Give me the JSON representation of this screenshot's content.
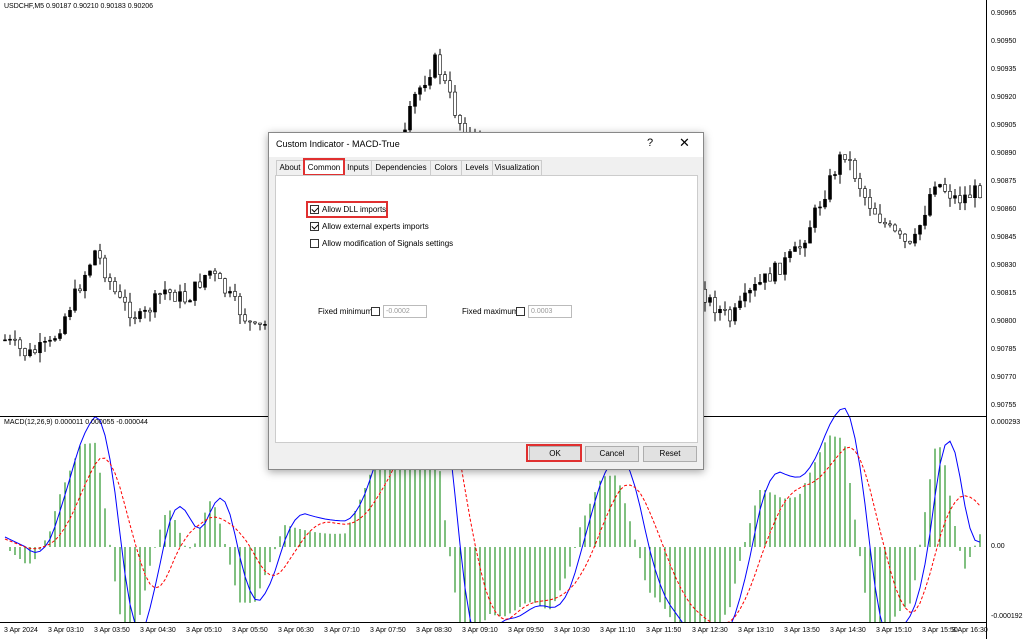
{
  "chart": {
    "symbol_info": "USDCHF,M5  0.90187 0.90210 0.90183 0.90206",
    "macd_info": "MACD(12,26,9) 0.000011 0.000055 -0.000044",
    "price_labels": [
      "0.90965",
      "0.90950",
      "0.90935",
      "0.90920",
      "0.90905",
      "0.90890",
      "0.90875",
      "0.90860",
      "0.90845",
      "0.90830",
      "0.90815",
      "0.90800",
      "0.90785",
      "0.90770",
      "0.90755"
    ],
    "macd_labels": [
      "0.000293",
      "0.00",
      "-0.000192"
    ],
    "time_labels": [
      "3 Apr 2024",
      "3 Apr 03:10",
      "3 Apr 03:50",
      "3 Apr 04:30",
      "3 Apr 05:10",
      "3 Apr 05:50",
      "3 Apr 06:30",
      "3 Apr 07:10",
      "3 Apr 07:50",
      "3 Apr 08:30",
      "3 Apr 09:10",
      "3 Apr 09:50",
      "3 Apr 10:30",
      "3 Apr 11:10",
      "3 Apr 11:50",
      "3 Apr 12:30",
      "3 Apr 13:10",
      "3 Apr 13:50",
      "3 Apr 14:30",
      "3 Apr 15:10",
      "3 Apr 15:50",
      "3 Apr 16:30"
    ]
  },
  "dialog": {
    "title": "Custom Indicator - MACD-True",
    "help": "?",
    "close": "✕",
    "tabs": [
      "About",
      "Common",
      "Inputs",
      "Dependencies",
      "Colors",
      "Levels",
      "Visualization"
    ],
    "active_tab": "Common",
    "checkboxes": [
      {
        "label": "Allow DLL imports",
        "checked": true
      },
      {
        "label": "Allow external experts imports",
        "checked": true
      },
      {
        "label": "Allow modification of Signals settings",
        "checked": false
      }
    ],
    "fixed_minimum": {
      "label": "Fixed minimum",
      "value": "-0.0002"
    },
    "fixed_maximum": {
      "label": "Fixed maximum",
      "value": "0.0003"
    },
    "buttons": {
      "ok": "OK",
      "cancel": "Cancel",
      "reset": "Reset"
    }
  },
  "colors": {
    "macd_line": "#0000ff",
    "signal_line": "#ff0000",
    "histogram": "#008000",
    "highlight": "#e03030"
  }
}
